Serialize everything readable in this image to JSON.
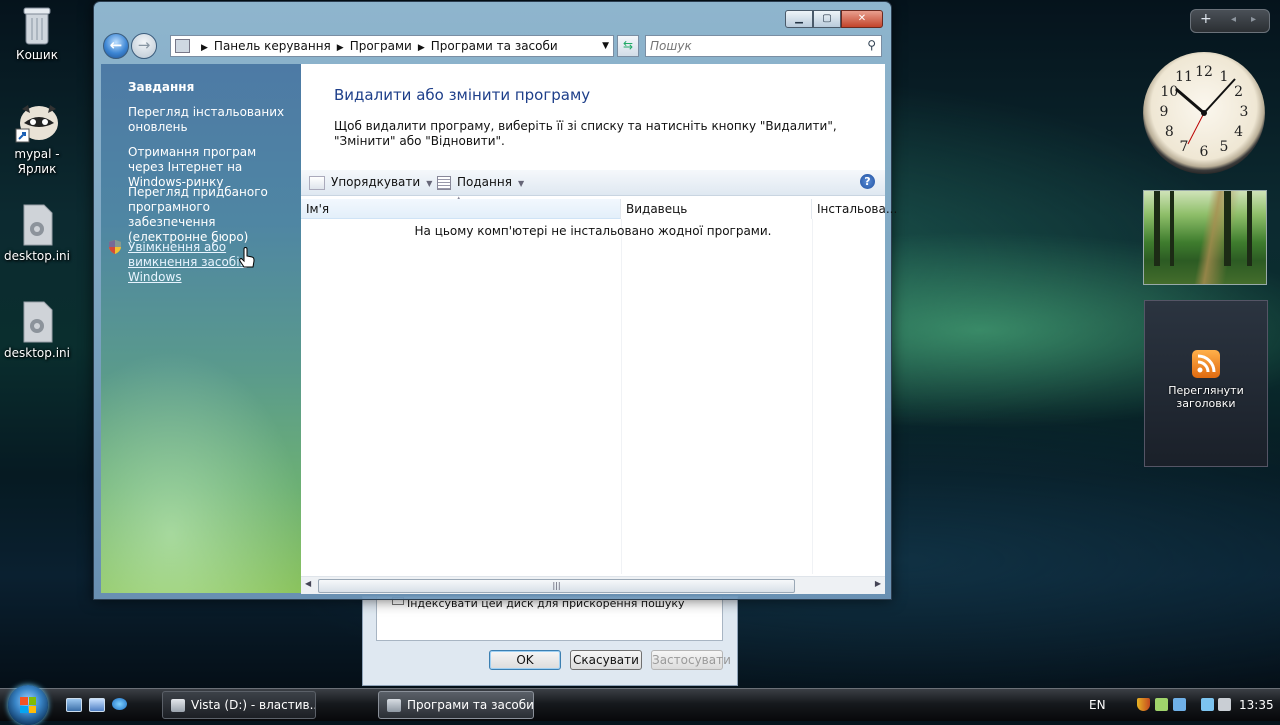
{
  "desktop": {
    "icons": [
      {
        "label": "Кошик"
      },
      {
        "label": "mypal - Ярлик"
      },
      {
        "label": "desktop.ini"
      },
      {
        "label": "desktop.ini"
      }
    ]
  },
  "gadgets": {
    "clock_numbers": [
      "12",
      "1",
      "2",
      "3",
      "4",
      "5",
      "6",
      "7",
      "8",
      "9",
      "10",
      "11"
    ],
    "rss_label": "Переглянути заголовки"
  },
  "window": {
    "breadcrumb": [
      "Панель керування",
      "Програми",
      "Програми та засоби"
    ],
    "search_placeholder": "Пошук",
    "tasks": {
      "header": "Завдання",
      "links": [
        "Перегляд інстальованих оновлень",
        "Отримання програм через Інтернет на Windows-ринку",
        "Перегляд придбаного програмного забезпечення (електронне бюро)",
        "Увімкнення або вимкнення засобів Windows"
      ]
    },
    "main": {
      "title": "Видалити або змінити програму",
      "description": "Щоб видалити програму, виберіть її зі списку та натисніть кнопку \"Видалити\", \"Змінити\" або \"Відновити\".",
      "toolbar": {
        "organize": "Упорядкувати",
        "views": "Подання"
      },
      "columns": [
        "Ім'я",
        "Видавець",
        "Інстальова..."
      ],
      "empty_message": "На цьому комп'ютері не інстальовано жодної програми."
    }
  },
  "dialog": {
    "checkbox_label": "Індексувати цей диск для прискорення пошуку",
    "ok": "OK",
    "cancel": "Скасувати",
    "apply": "Застосувати"
  },
  "taskbar": {
    "buttons": [
      "Vista (D:) - властив...",
      "Програми та засоби"
    ],
    "language": "EN",
    "time": "13:35"
  }
}
